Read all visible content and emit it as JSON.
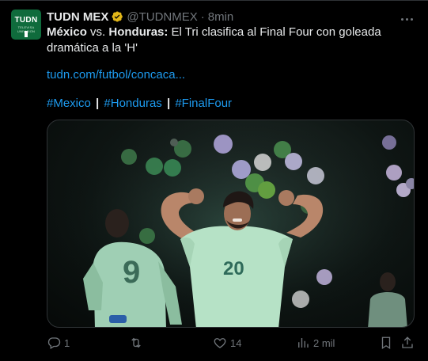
{
  "tweet": {
    "avatar_text": "TUDN",
    "avatar_sub": "TELEVISA UNIVISION",
    "display_name": "TUDN MEX",
    "handle": "@TUDNMEX",
    "separator": "·",
    "time": "8min",
    "text_bold_1": "México",
    "text_mid": " vs. ",
    "text_bold_2": "Honduras:",
    "text_rest": " El Tri clasifica al Final Four con goleada dramática a la 'H'",
    "link": "tudn.com/futbol/concaca...",
    "hashtags": [
      "#Mexico",
      "#Honduras",
      "#FinalFour"
    ],
    "hashtag_separator": "|",
    "media_player_number": "20",
    "media_player2_number": "9",
    "icons": {
      "verified": "verified-badge-icon",
      "more": "more-icon",
      "reply": "reply-icon",
      "retweet": "retweet-icon",
      "like": "heart-icon",
      "views": "views-icon",
      "bookmark": "bookmark-icon",
      "share": "share-icon"
    },
    "actions": {
      "reply_count": "1",
      "retweet_count": "",
      "like_count": "14",
      "views_count": "2 mil"
    },
    "colors": {
      "background": "#000000",
      "accent": "#1d9bf0",
      "muted": "#71767b",
      "verified": "#e2b719",
      "avatar_bg": "#0f6b3c"
    }
  }
}
